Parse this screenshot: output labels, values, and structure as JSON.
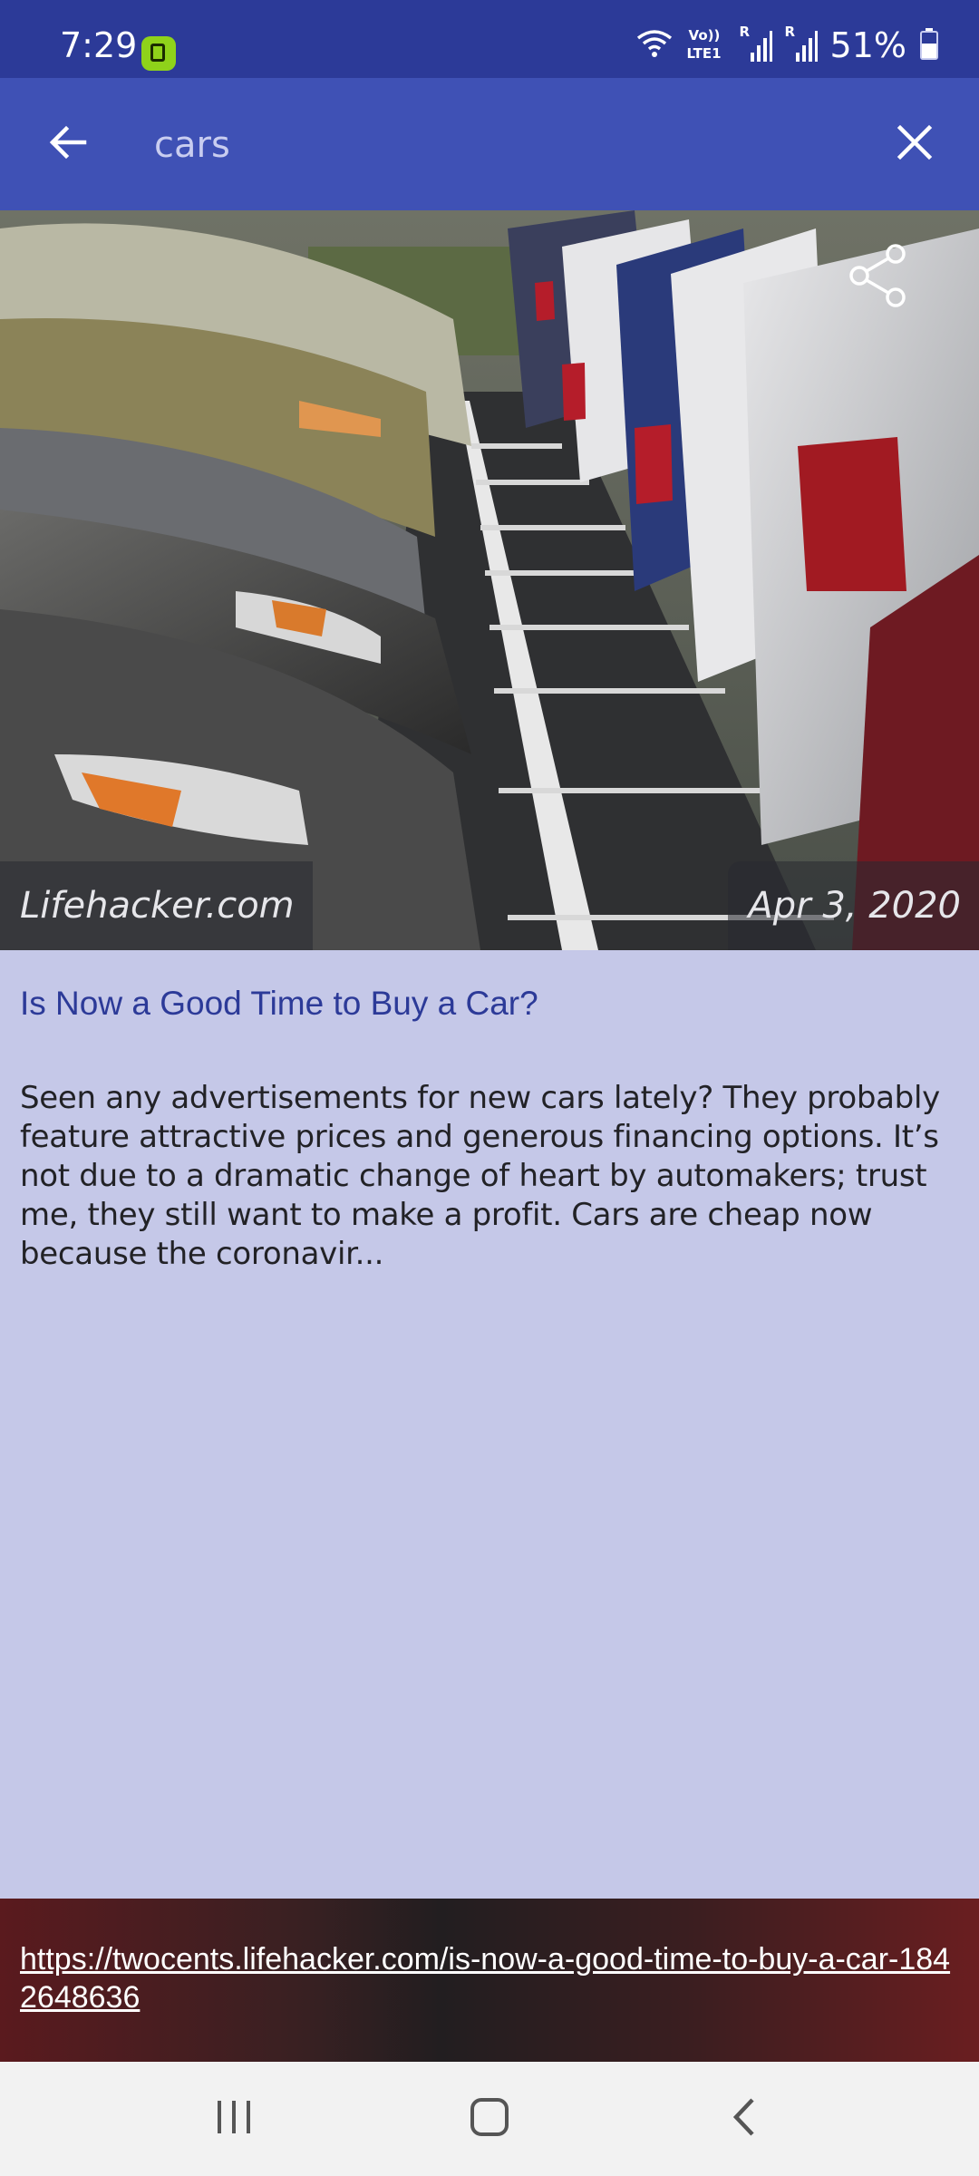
{
  "status_bar": {
    "time": "7:29",
    "battery_percent": "51%",
    "icons": [
      "screen-recorder-icon",
      "wifi-icon",
      "volte-lte-icon",
      "signal-icon",
      "signal-icon",
      "battery-icon"
    ],
    "network_label_top": "Vo))",
    "network_label_bottom": "LTE1",
    "roaming_label": "R"
  },
  "app_bar": {
    "search_query": "cars",
    "back_icon": "arrow-left-icon",
    "close_icon": "close-icon"
  },
  "article": {
    "source": "Lifehacker.com",
    "date": "Apr 3, 2020",
    "title": "Is Now a Good Time to Buy a Car?",
    "summary": "Seen any advertisements for new cars lately? They probably feature attractive prices and generous financing options. It’s not due to a dramatic change of heart by automakers; trust me, they still want to make a profit. Cars are cheap now because the coronavir...",
    "url": "https://twocents.lifehacker.com/is-now-a-good-time-to-buy-a-car-1842648636",
    "share_icon": "share-icon",
    "image_subject": "rows of parked cars"
  },
  "nav_bar": {
    "icons": [
      "recents-icon",
      "home-icon",
      "back-icon"
    ]
  },
  "colors": {
    "status_bar": "#2c3a98",
    "app_bar": "#3f51b5",
    "article_background": "#c5c8e8",
    "title_color": "#2c3a98",
    "link_bar_background": "#5a1a1e"
  }
}
